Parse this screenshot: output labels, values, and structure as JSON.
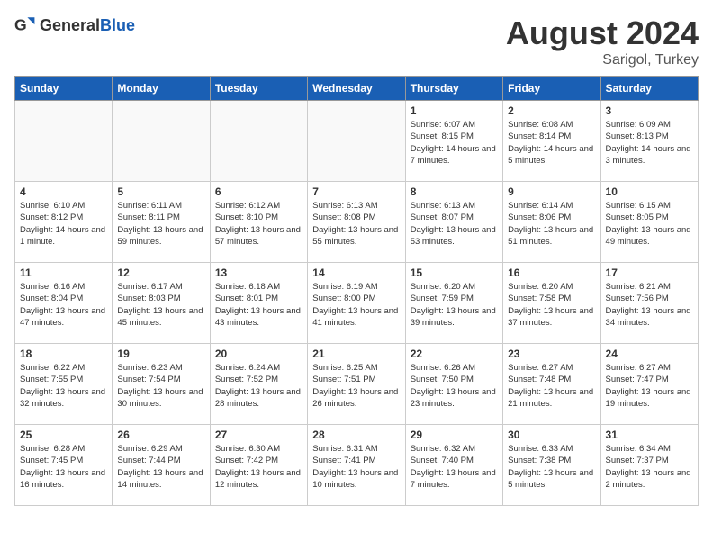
{
  "header": {
    "logo_general": "General",
    "logo_blue": "Blue",
    "month_title": "August 2024",
    "subtitle": "Sarigol, Turkey"
  },
  "weekdays": [
    "Sunday",
    "Monday",
    "Tuesday",
    "Wednesday",
    "Thursday",
    "Friday",
    "Saturday"
  ],
  "weeks": [
    [
      {
        "day": "",
        "empty": true
      },
      {
        "day": "",
        "empty": true
      },
      {
        "day": "",
        "empty": true
      },
      {
        "day": "",
        "empty": true
      },
      {
        "day": "1",
        "sunrise": "6:07 AM",
        "sunset": "8:15 PM",
        "daylight": "14 hours and 7 minutes."
      },
      {
        "day": "2",
        "sunrise": "6:08 AM",
        "sunset": "8:14 PM",
        "daylight": "14 hours and 5 minutes."
      },
      {
        "day": "3",
        "sunrise": "6:09 AM",
        "sunset": "8:13 PM",
        "daylight": "14 hours and 3 minutes."
      }
    ],
    [
      {
        "day": "4",
        "sunrise": "6:10 AM",
        "sunset": "8:12 PM",
        "daylight": "14 hours and 1 minute."
      },
      {
        "day": "5",
        "sunrise": "6:11 AM",
        "sunset": "8:11 PM",
        "daylight": "13 hours and 59 minutes."
      },
      {
        "day": "6",
        "sunrise": "6:12 AM",
        "sunset": "8:10 PM",
        "daylight": "13 hours and 57 minutes."
      },
      {
        "day": "7",
        "sunrise": "6:13 AM",
        "sunset": "8:08 PM",
        "daylight": "13 hours and 55 minutes."
      },
      {
        "day": "8",
        "sunrise": "6:13 AM",
        "sunset": "8:07 PM",
        "daylight": "13 hours and 53 minutes."
      },
      {
        "day": "9",
        "sunrise": "6:14 AM",
        "sunset": "8:06 PM",
        "daylight": "13 hours and 51 minutes."
      },
      {
        "day": "10",
        "sunrise": "6:15 AM",
        "sunset": "8:05 PM",
        "daylight": "13 hours and 49 minutes."
      }
    ],
    [
      {
        "day": "11",
        "sunrise": "6:16 AM",
        "sunset": "8:04 PM",
        "daylight": "13 hours and 47 minutes."
      },
      {
        "day": "12",
        "sunrise": "6:17 AM",
        "sunset": "8:03 PM",
        "daylight": "13 hours and 45 minutes."
      },
      {
        "day": "13",
        "sunrise": "6:18 AM",
        "sunset": "8:01 PM",
        "daylight": "13 hours and 43 minutes."
      },
      {
        "day": "14",
        "sunrise": "6:19 AM",
        "sunset": "8:00 PM",
        "daylight": "13 hours and 41 minutes."
      },
      {
        "day": "15",
        "sunrise": "6:20 AM",
        "sunset": "7:59 PM",
        "daylight": "13 hours and 39 minutes."
      },
      {
        "day": "16",
        "sunrise": "6:20 AM",
        "sunset": "7:58 PM",
        "daylight": "13 hours and 37 minutes."
      },
      {
        "day": "17",
        "sunrise": "6:21 AM",
        "sunset": "7:56 PM",
        "daylight": "13 hours and 34 minutes."
      }
    ],
    [
      {
        "day": "18",
        "sunrise": "6:22 AM",
        "sunset": "7:55 PM",
        "daylight": "13 hours and 32 minutes."
      },
      {
        "day": "19",
        "sunrise": "6:23 AM",
        "sunset": "7:54 PM",
        "daylight": "13 hours and 30 minutes."
      },
      {
        "day": "20",
        "sunrise": "6:24 AM",
        "sunset": "7:52 PM",
        "daylight": "13 hours and 28 minutes."
      },
      {
        "day": "21",
        "sunrise": "6:25 AM",
        "sunset": "7:51 PM",
        "daylight": "13 hours and 26 minutes."
      },
      {
        "day": "22",
        "sunrise": "6:26 AM",
        "sunset": "7:50 PM",
        "daylight": "13 hours and 23 minutes."
      },
      {
        "day": "23",
        "sunrise": "6:27 AM",
        "sunset": "7:48 PM",
        "daylight": "13 hours and 21 minutes."
      },
      {
        "day": "24",
        "sunrise": "6:27 AM",
        "sunset": "7:47 PM",
        "daylight": "13 hours and 19 minutes."
      }
    ],
    [
      {
        "day": "25",
        "sunrise": "6:28 AM",
        "sunset": "7:45 PM",
        "daylight": "13 hours and 16 minutes."
      },
      {
        "day": "26",
        "sunrise": "6:29 AM",
        "sunset": "7:44 PM",
        "daylight": "13 hours and 14 minutes."
      },
      {
        "day": "27",
        "sunrise": "6:30 AM",
        "sunset": "7:42 PM",
        "daylight": "13 hours and 12 minutes."
      },
      {
        "day": "28",
        "sunrise": "6:31 AM",
        "sunset": "7:41 PM",
        "daylight": "13 hours and 10 minutes."
      },
      {
        "day": "29",
        "sunrise": "6:32 AM",
        "sunset": "7:40 PM",
        "daylight": "13 hours and 7 minutes."
      },
      {
        "day": "30",
        "sunrise": "6:33 AM",
        "sunset": "7:38 PM",
        "daylight": "13 hours and 5 minutes."
      },
      {
        "day": "31",
        "sunrise": "6:34 AM",
        "sunset": "7:37 PM",
        "daylight": "13 hours and 2 minutes."
      }
    ]
  ]
}
